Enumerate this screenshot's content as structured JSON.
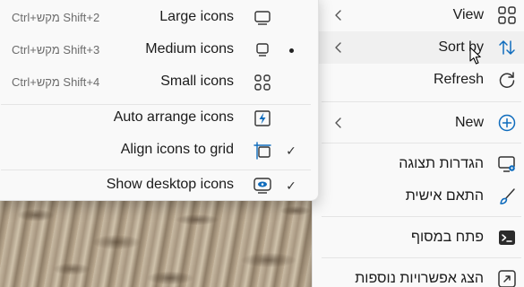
{
  "main_menu": {
    "items": [
      {
        "label": "View",
        "icon": "four-squares-icon",
        "has_submenu": true
      },
      {
        "label": "Sort by",
        "icon": "sort-arrows-icon",
        "has_submenu": true
      },
      {
        "label": "Refresh",
        "icon": "refresh-icon",
        "has_submenu": false
      },
      {
        "label": "New",
        "icon": "plus-circle-icon",
        "has_submenu": true
      },
      {
        "label": "הגדרות תצוגה",
        "icon": "display-settings-icon",
        "has_submenu": false
      },
      {
        "label": "התאם אישית",
        "icon": "brush-icon",
        "has_submenu": false
      },
      {
        "label": "פתח במסוף",
        "icon": "terminal-icon",
        "has_submenu": false
      },
      {
        "label": "הצג אפשרויות נוספות",
        "icon": "expand-icon",
        "has_submenu": false
      }
    ]
  },
  "view_submenu": {
    "items": [
      {
        "label": "Large icons",
        "shortcut": "Ctrl+מקש Shift+2",
        "icon": "monitor-large-icon",
        "state": ""
      },
      {
        "label": "Medium icons",
        "shortcut": "Ctrl+מקש Shift+3",
        "icon": "monitor-medium-icon",
        "state": "selected"
      },
      {
        "label": "Small icons",
        "shortcut": "Ctrl+מקש Shift+4",
        "icon": "small-grid-icon",
        "state": ""
      },
      {
        "label": "Auto arrange icons",
        "shortcut": "",
        "icon": "auto-arrange-icon",
        "state": ""
      },
      {
        "label": "Align icons to grid",
        "shortcut": "",
        "icon": "align-grid-icon",
        "state": "checked"
      },
      {
        "label": "Show desktop icons",
        "shortcut": "",
        "icon": "show-desktop-icon",
        "state": "checked"
      }
    ],
    "check_glyph": "✓"
  },
  "colors": {
    "menu_bg": "#f9f9f9",
    "hover_bg": "#f0f0f0",
    "accent_blue": "#0f6cbd",
    "text": "#1b1b1b",
    "shortcut_text": "#6c6c6c"
  }
}
